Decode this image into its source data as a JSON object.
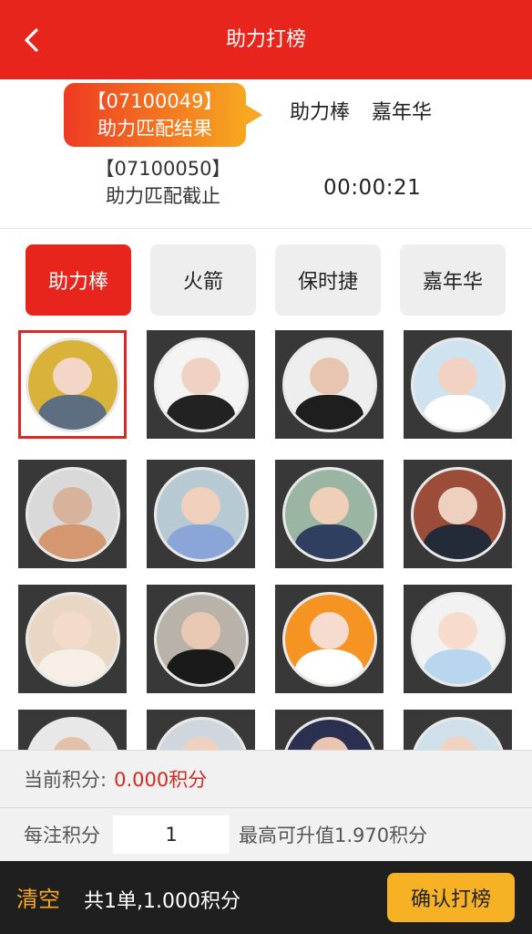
{
  "header": {
    "title": "助力打榜",
    "back_icon": "back-arrow-icon"
  },
  "info": {
    "last_issue": {
      "number": "【07100049】",
      "label": "助力匹配结果"
    },
    "matched_items": [
      "助力棒",
      "嘉年华"
    ],
    "next_issue": {
      "number": "【07100050】",
      "label": "助力匹配截止"
    },
    "countdown": "00:00:21"
  },
  "tabs": [
    {
      "label": "助力棒",
      "active": true
    },
    {
      "label": "火箭",
      "active": false
    },
    {
      "label": "保时捷",
      "active": false
    },
    {
      "label": "嘉年华",
      "active": false
    }
  ],
  "grid": {
    "avatars": [
      {
        "selected": true,
        "bg": "#d9b23a",
        "skin": "#f3d6c6",
        "cloth": "#5c6e80"
      },
      {
        "selected": false,
        "bg": "#f4f4f4",
        "skin": "#f0d2c2",
        "cloth": "#222222"
      },
      {
        "selected": false,
        "bg": "#eeeeee",
        "skin": "#e8c5b0",
        "cloth": "#1e1e1e"
      },
      {
        "selected": false,
        "bg": "#cfe2ef",
        "skin": "#f2d3c3",
        "cloth": "#ffffff"
      },
      {
        "selected": false,
        "bg": "#d9d9d9",
        "skin": "#d8b39c",
        "cloth": "#d4976f"
      },
      {
        "selected": false,
        "bg": "#b7c9d3",
        "skin": "#efd0bd",
        "cloth": "#8aa6d8"
      },
      {
        "selected": false,
        "bg": "#9bb5a3",
        "skin": "#f0cfb8",
        "cloth": "#2f3f60"
      },
      {
        "selected": false,
        "bg": "#9c4d3a",
        "skin": "#edd0be",
        "cloth": "#232a38"
      },
      {
        "selected": false,
        "bg": "#ead7c3",
        "skin": "#f4dacb",
        "cloth": "#f7efe6"
      },
      {
        "selected": false,
        "bg": "#b8b2a8",
        "skin": "#e9c8b4",
        "cloth": "#1a1a1a"
      },
      {
        "selected": false,
        "bg": "#f59422",
        "skin": "#f6dccf",
        "cloth": "#ffffff"
      },
      {
        "selected": false,
        "bg": "#f2f2f2",
        "skin": "#f7dccd",
        "cloth": "#b8d7ef"
      },
      {
        "selected": false,
        "bg": "#e8e8e8",
        "skin": "#e4c0a8",
        "cloth": "#3a3a3a"
      },
      {
        "selected": false,
        "bg": "#d0d6de",
        "skin": "#f0d0bf",
        "cloth": "#7d8fa5"
      },
      {
        "selected": false,
        "bg": "#2b3050",
        "skin": "#e8c6b2",
        "cloth": "#1c1c2c"
      },
      {
        "selected": false,
        "bg": "#cfe0ea",
        "skin": "#f1d3c2",
        "cloth": "#546b82"
      }
    ]
  },
  "points": {
    "label": "当前积分:",
    "value": "0.000积分"
  },
  "stake": {
    "label": "每注积分",
    "value": "1",
    "max_label": "最高可升值1.970积分"
  },
  "footer": {
    "clear_label": "清空",
    "summary": "共1单,1.000积分",
    "confirm_label": "确认打榜"
  },
  "colors": {
    "primary": "#e8251c",
    "accent": "#f6a820",
    "footer_bg": "#1f1f1f"
  }
}
